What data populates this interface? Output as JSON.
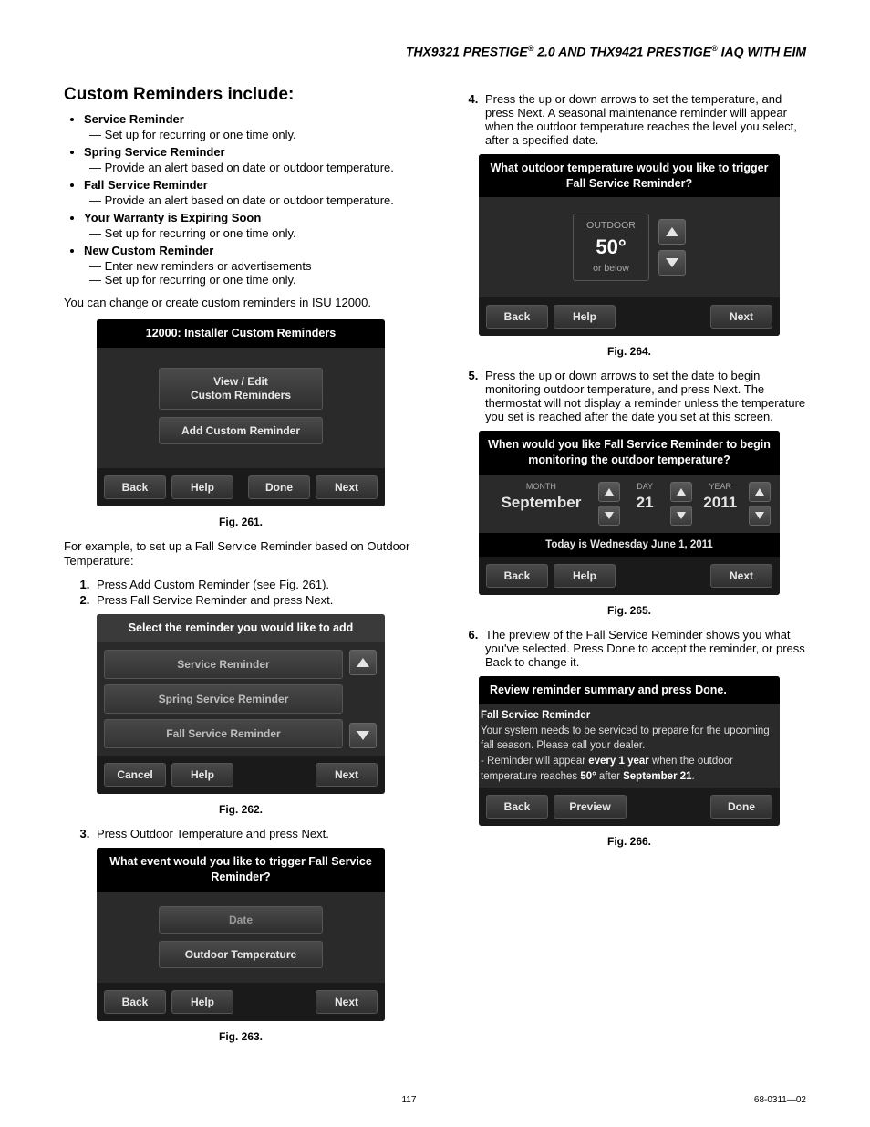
{
  "header": {
    "p1": "THX9321 PRESTIGE",
    "reg": "®",
    "p2": " 2.0 AND THX9421 PRESTIGE",
    "p3": " IAQ WITH EIM"
  },
  "heading": "Custom Reminders include:",
  "bullets": [
    {
      "t": "Service Reminder",
      "s": [
        "Set up for recurring or one time only."
      ]
    },
    {
      "t": "Spring Service Reminder",
      "s": [
        "Provide an alert based on date or outdoor temperature."
      ]
    },
    {
      "t": "Fall Service Reminder",
      "s": [
        "Provide an alert based on date or outdoor temperature."
      ]
    },
    {
      "t": "Your Warranty is Expiring Soon",
      "s": [
        "Set up for recurring or one time only."
      ]
    },
    {
      "t": "New Custom Reminder",
      "s": [
        "Enter new reminders or advertisements",
        "Set up for recurring or one time only."
      ]
    }
  ],
  "p1": "You can change or create custom reminders in ISU 12000.",
  "fig261": {
    "title": "12000: Installer Custom Reminders",
    "btn1": "View / Edit\nCustom Reminders",
    "btn2": "Add Custom Reminder",
    "back": "Back",
    "help": "Help",
    "done": "Done",
    "next": "Next",
    "cap": "Fig. 261."
  },
  "p2": "For example, to set up a Fall Service Reminder based on Outdoor Temperature:",
  "steps12": [
    "Press Add Custom Reminder (see Fig. 261).",
    "Press Fall Service Reminder and press Next."
  ],
  "fig262": {
    "title": "Select the reminder you would like to add",
    "i1": "Service Reminder",
    "i2": "Spring Service Reminder",
    "i3": "Fall Service Reminder",
    "cancel": "Cancel",
    "help": "Help",
    "next": "Next",
    "cap": "Fig. 262."
  },
  "step3": "Press Outdoor Temperature and press Next.",
  "fig263": {
    "title": "What event would you like to trigger Fall Service Reminder?",
    "b1": "Date",
    "b2": "Outdoor Temperature",
    "back": "Back",
    "help": "Help",
    "next": "Next",
    "cap": "Fig. 263."
  },
  "step4": "Press the up or down arrows to set the temperature, and press Next. A seasonal maintenance reminder will appear when the outdoor temperature reaches the level you select, after a specified date.",
  "fig264": {
    "title": "What outdoor temperature would you like to trigger Fall Service Reminder?",
    "outdoor": "OUTDOOR",
    "temp": "50°",
    "below": "or below",
    "back": "Back",
    "help": "Help",
    "next": "Next",
    "cap": "Fig. 264."
  },
  "step5": "Press the up or down arrows to set the date to begin monitoring outdoor temperature, and press Next. The thermostat will not display a reminder unless the temperature you set is reached after the date you set at this screen.",
  "fig265": {
    "title": "When would you like Fall Service Reminder to begin monitoring the outdoor temperature?",
    "mL": "MONTH",
    "dL": "DAY",
    "yL": "YEAR",
    "m": "September",
    "d": "21",
    "y": "2011",
    "today": "Today is Wednesday June 1, 2011",
    "back": "Back",
    "help": "Help",
    "next": "Next",
    "cap": "Fig. 265."
  },
  "step6": "The preview of the Fall Service Reminder shows you what you've selected. Press Done to accept the reminder, or press Back to change it.",
  "fig266": {
    "title": "Review reminder summary and press Done.",
    "h": "Fall Service Reminder",
    "l1": "Your system needs to be serviced to prepare for the upcoming fall season. Please call your dealer.",
    "l2a": "- Reminder will appear ",
    "l2b": "every 1 year",
    "l2c": " when the outdoor temperature reaches ",
    "l2d": "50°",
    "l2e": " after ",
    "l2f": "September 21",
    "l2g": ".",
    "back": "Back",
    "preview": "Preview",
    "done": "Done",
    "cap": "Fig. 266."
  },
  "footer": {
    "page": "117",
    "doc": "68-0311—02"
  }
}
